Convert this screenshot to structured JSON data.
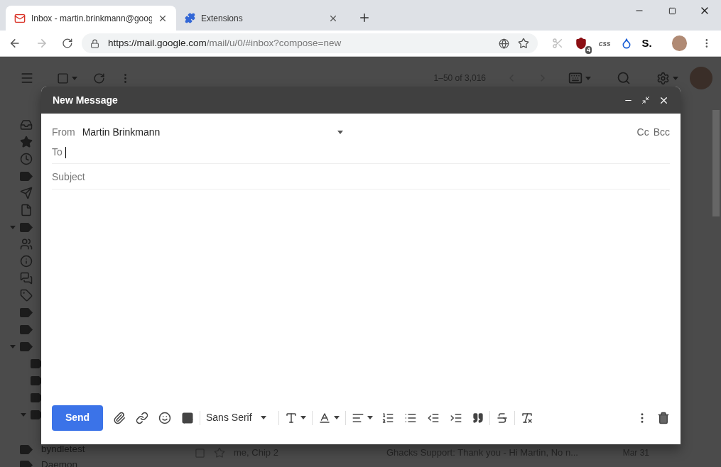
{
  "browser": {
    "tabs": [
      {
        "title": "Inbox - martin.brinkmann@goog",
        "selected": true
      },
      {
        "title": "Extensions",
        "selected": false
      }
    ],
    "url": {
      "host": "https://mail.google.com",
      "path": "/mail/u/0/#inbox?compose=new"
    },
    "extensions": [
      {
        "kind": "scissors"
      },
      {
        "kind": "shield",
        "badge": "4"
      },
      {
        "kind": "css",
        "label": "css"
      },
      {
        "kind": "drop"
      },
      {
        "kind": "brand",
        "label": "S."
      }
    ]
  },
  "mailbox": {
    "pagination": "1–50 of 3,016",
    "labels": [
      "byndletest",
      "Daemon"
    ],
    "rows": [
      {
        "from": "me, Chip 2",
        "subject": "Ghacks Support: Thank you - Hi Martin, No n...",
        "date": "Mar 31",
        "starred": false
      }
    ]
  },
  "compose": {
    "title": "New Message",
    "from_label": "From",
    "from": "Martin Brinkmann",
    "cc": "Cc",
    "bcc": "Bcc",
    "to_label": "To",
    "subject_placeholder": "Subject",
    "send": "Send",
    "font": "Sans Serif"
  }
}
